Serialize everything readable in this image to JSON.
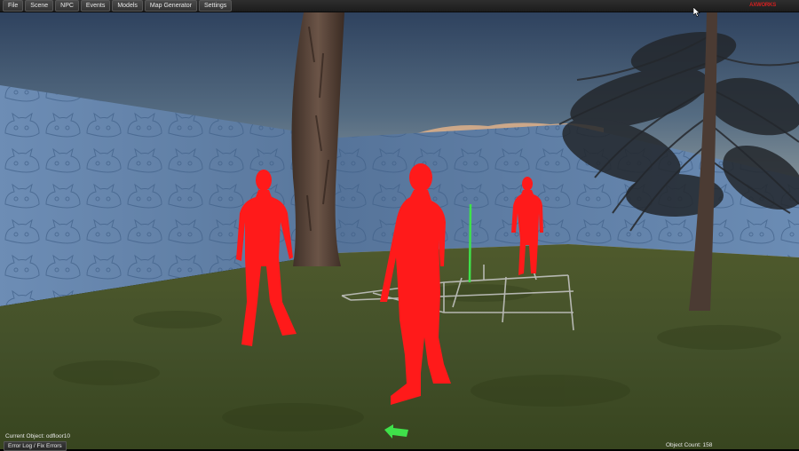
{
  "menu": {
    "items": [
      "File",
      "Scene",
      "NPC",
      "Events",
      "Models",
      "Map Generator",
      "Settings"
    ]
  },
  "brand": {
    "logo_text": "AXWORKS"
  },
  "status": {
    "current_object": "Current Object: odfloor10",
    "error_log_label": "Error Log / Fix Errors",
    "object_count": "Object Count: 158"
  },
  "scene": {
    "npc_color": "#ff1a1a",
    "gizmo_color": "#3fe14a",
    "sky_top": "#2a3a55",
    "sky_bottom": "#e8a36a",
    "ground_color": "#4a5a28",
    "wall_color": "#5f7ea5"
  }
}
